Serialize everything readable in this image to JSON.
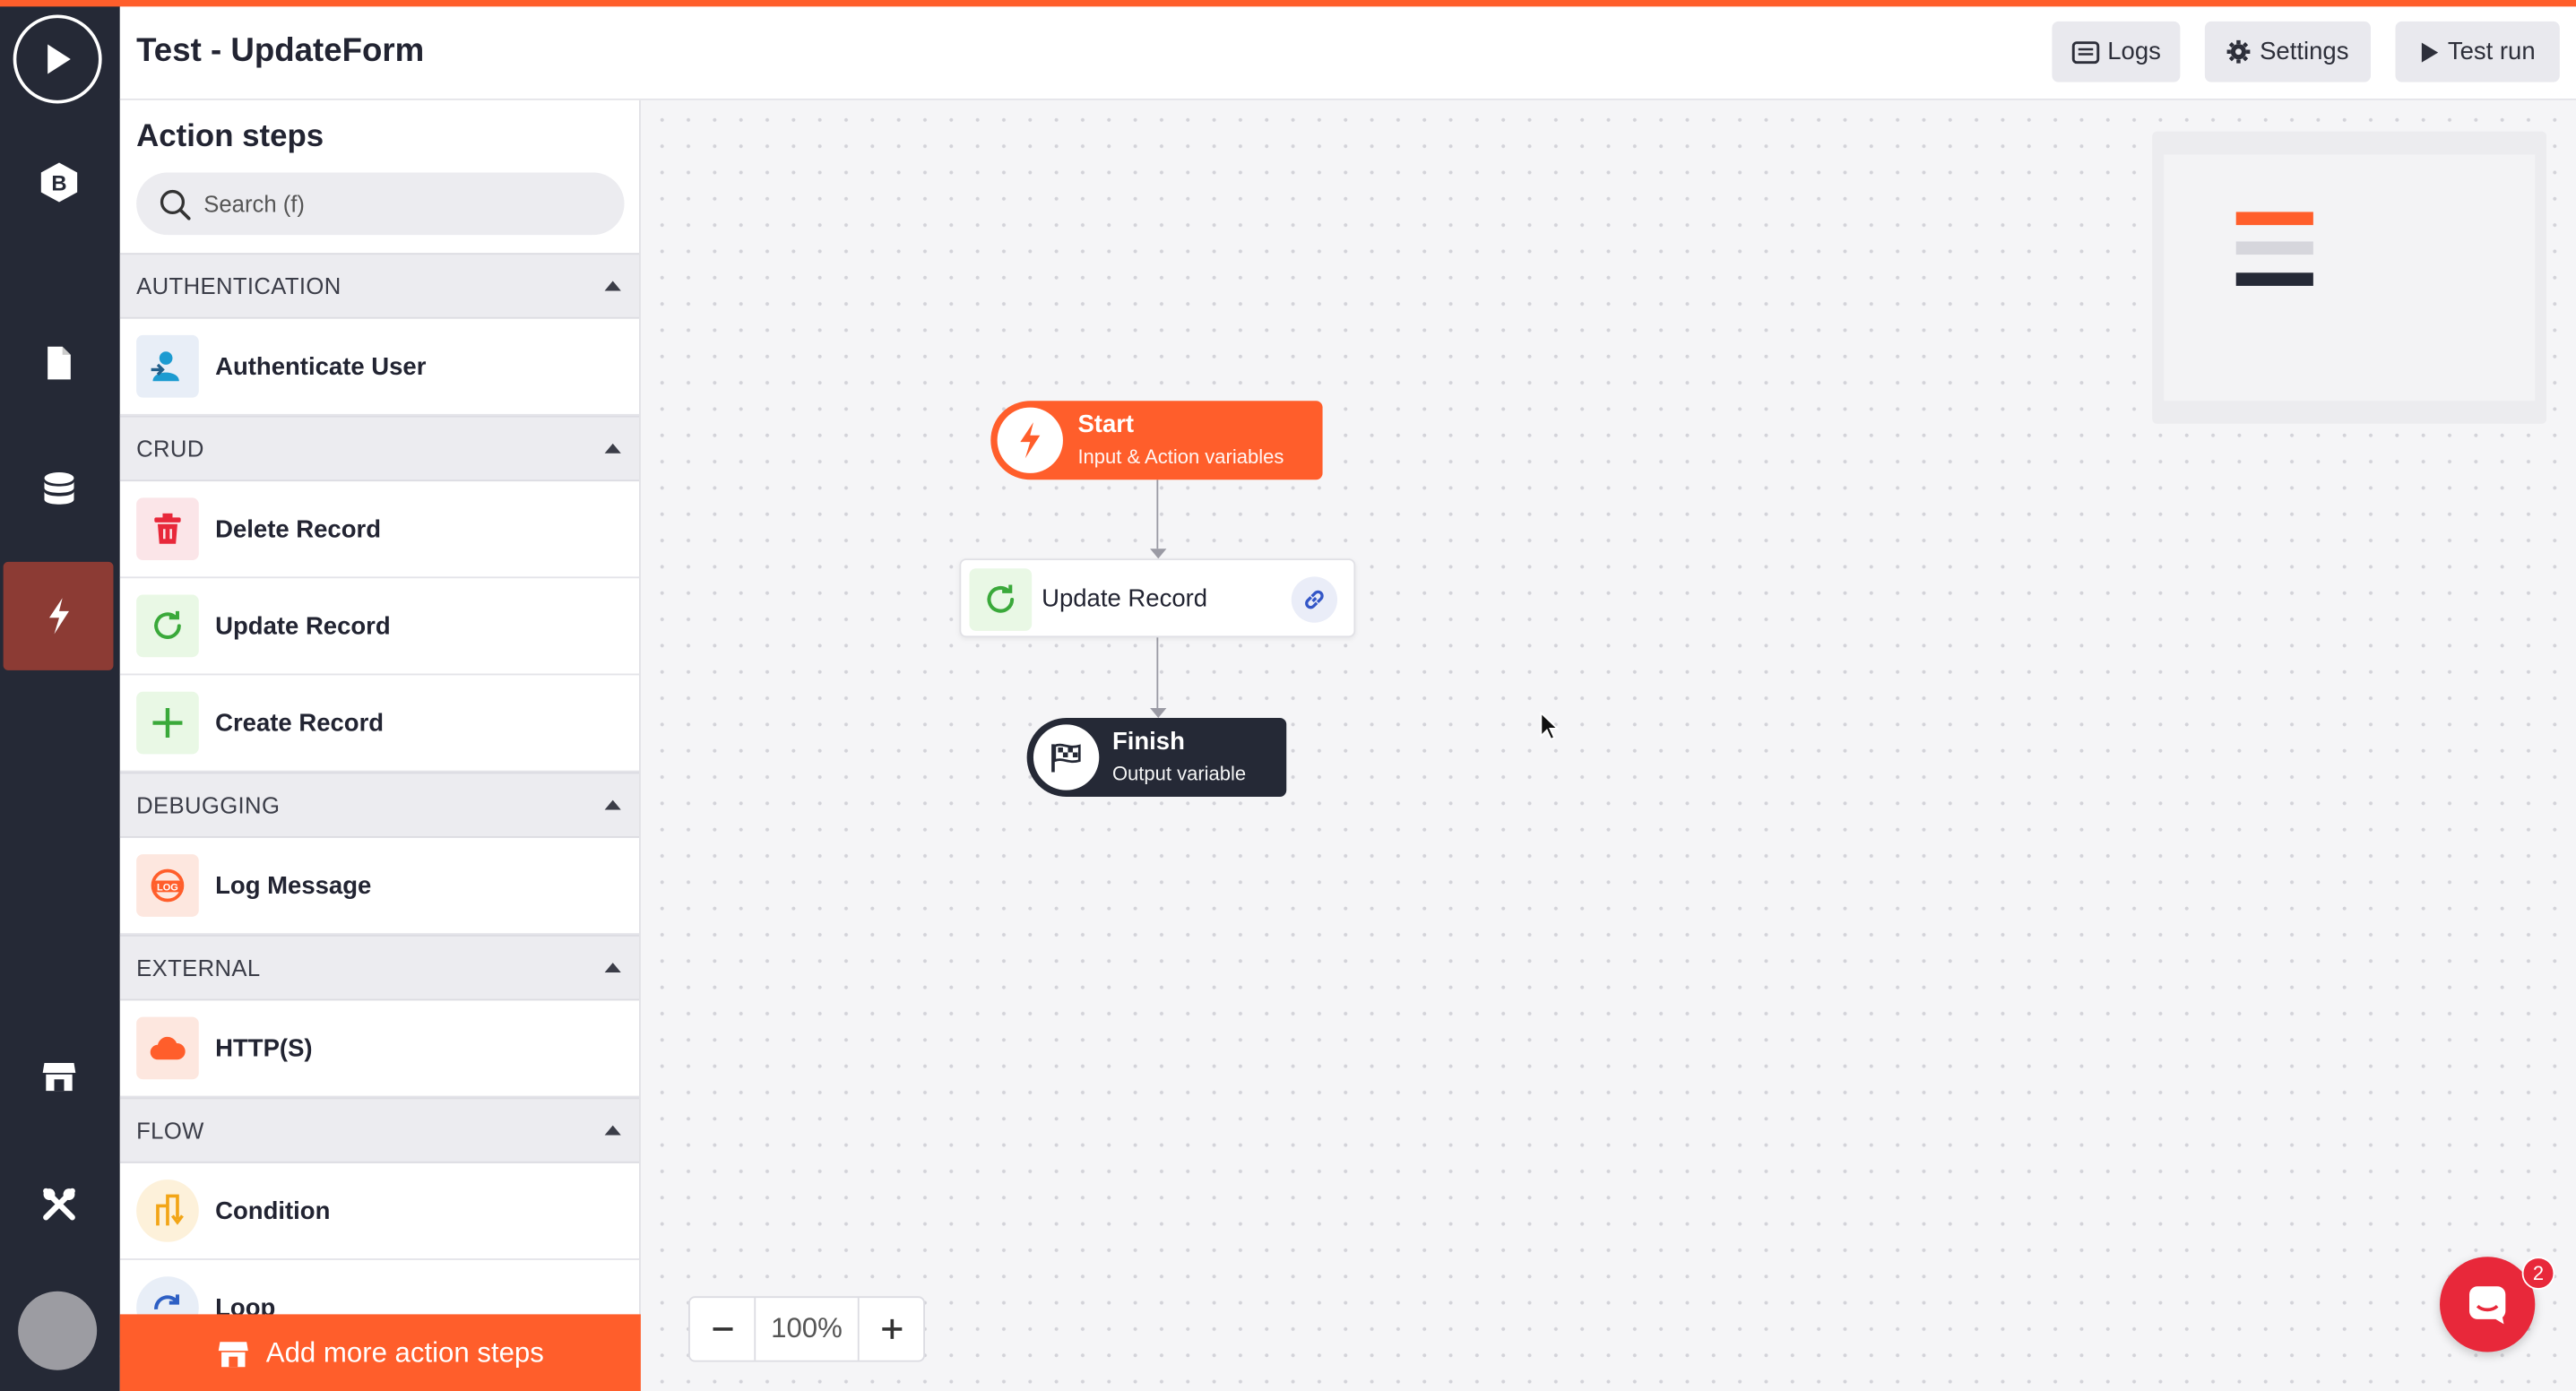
{
  "app": {
    "rail": {
      "items": [
        {
          "icon": "brand-b-icon"
        },
        {
          "icon": "page-icon"
        },
        {
          "icon": "database-icon"
        },
        {
          "icon": "lightning-icon",
          "active": true
        },
        {
          "icon": "store-icon"
        },
        {
          "icon": "tools-icon"
        }
      ]
    }
  },
  "header": {
    "title": "Test - UpdateForm",
    "logs_label": "Logs",
    "settings_label": "Settings",
    "test_run_label": "Test run"
  },
  "sidebar": {
    "title": "Action steps",
    "search_placeholder": "Search (f)",
    "categories": [
      {
        "name": "AUTHENTICATION",
        "items": [
          {
            "label": "Authenticate User",
            "icon": "user-icon"
          }
        ]
      },
      {
        "name": "CRUD",
        "items": [
          {
            "label": "Delete Record",
            "icon": "trash-icon"
          },
          {
            "label": "Update Record",
            "icon": "refresh-icon"
          },
          {
            "label": "Create Record",
            "icon": "plus-icon"
          }
        ]
      },
      {
        "name": "DEBUGGING",
        "items": [
          {
            "label": "Log Message",
            "icon": "log-icon"
          }
        ]
      },
      {
        "name": "EXTERNAL",
        "items": [
          {
            "label": "HTTP(S)",
            "icon": "cloud-icon"
          }
        ]
      },
      {
        "name": "FLOW",
        "items": [
          {
            "label": "Condition",
            "icon": "condition-icon"
          },
          {
            "label": "Loop",
            "icon": "loop-icon"
          }
        ]
      }
    ],
    "add_more_label": "Add more action steps"
  },
  "canvas": {
    "start_node": {
      "title": "Start",
      "subtitle": "Input & Action variables"
    },
    "update_node": {
      "label": "Update Record"
    },
    "finish_node": {
      "title": "Finish",
      "subtitle": "Output variable"
    },
    "zoom_level": "100%",
    "chat_badge": "2"
  },
  "colors": {
    "accent": "#ff5e2b",
    "rail_bg": "#252936",
    "rail_active": "#8c3b34",
    "finish_bg": "#252936",
    "chat": "#e8283a"
  }
}
